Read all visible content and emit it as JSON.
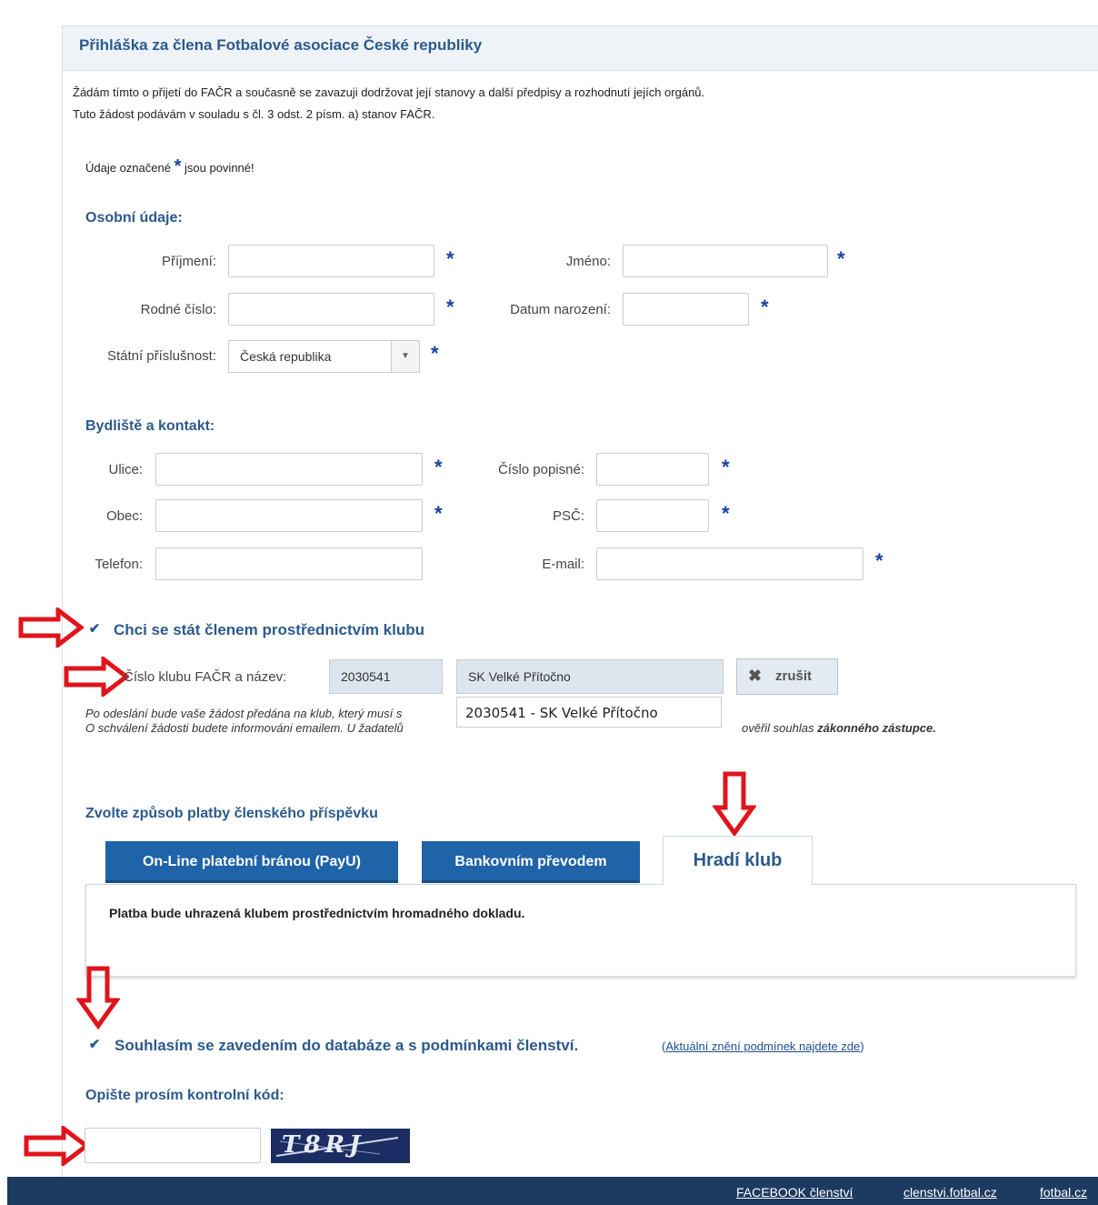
{
  "panel": {
    "title": "Přihláška za člena Fotbalové asociace České republiky",
    "intro_line1": "Žádám tímto o přijetí do FAČR a současně se zavazuji dodržovat její stanovy a další předpisy a rozhodnutí jejích orgánů.",
    "intro_line2": "Tuto žádost podávám v souladu s čl. 3 odst. 2 písm. a) stanov FAČR.",
    "required_pre": "Údaje označené",
    "required_star": "*",
    "required_post": "jsou povinné!"
  },
  "personal": {
    "heading": "Osobní údaje:",
    "surname_label": "Příjmení:",
    "name_label": "Jméno:",
    "birth_number_label": "Rodné číslo:",
    "birth_date_label": "Datum narození:",
    "nationality_label": "Státní příslušnost:",
    "nationality_value": "Česká republika"
  },
  "address": {
    "heading": "Bydliště a kontakt:",
    "street_label": "Ulice:",
    "house_number_label": "Číslo popisné:",
    "city_label": "Obec:",
    "zip_label": "PSČ:",
    "phone_label": "Telefon:",
    "email_label": "E-mail:"
  },
  "club": {
    "checkbox_label": "Chci se stát členem prostřednictvím klubu",
    "checked": true,
    "club_label": "Číslo klubu FAČR a název:",
    "club_number": "2030541",
    "club_name": "SK Velké Přítočno",
    "cancel_label": "zrušit",
    "dropdown_option": "2030541 - SK Velké Přítočno",
    "note_line1": "Po odeslání bude vaše žádost předána na klub, který musí s",
    "note_line2": "O schválení žádosti budete informováni emailem. U žadatelů",
    "note_line2_end": "ověřil souhlas",
    "note_line2_bold": "zákonného zástupce."
  },
  "payment": {
    "heading": "Zvolte způsob platby členského příspěvku",
    "tabs": [
      "On-Line platební bránou (PayU)",
      "Bankovním převodem",
      "Hradí klub"
    ],
    "active_tab": 2,
    "active_text": "Platba bude uhrazená klubem prostřednictvím hromadného dokladu."
  },
  "consent": {
    "label": "Souhlasím se zavedením do databáze a s podmínkami členství.",
    "checked": true,
    "link_prefix": "(",
    "link_text": "Aktuální znění podmínek najdete zde",
    "link_suffix": ")"
  },
  "captcha": {
    "heading": "Opište prosím kontrolní kód:",
    "image_text": "T8RJ"
  },
  "footer": {
    "links": [
      "FACEBOOK členství",
      "clenstvi.fotbal.cz",
      "fotbal.cz"
    ]
  },
  "colors": {
    "accent": "#2c5a8c",
    "tab_blue": "#1f63a8",
    "star": "#1b3fa6",
    "arrow": "#e0141b",
    "footer": "#1d3a60"
  }
}
